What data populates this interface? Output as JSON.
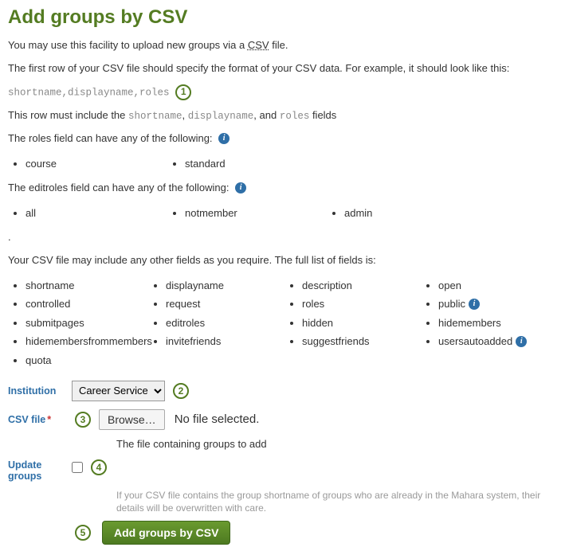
{
  "title": "Add groups by CSV",
  "intro_prefix": "You may use this facility to upload new groups via a ",
  "intro_csv_link": "CSV",
  "intro_suffix": " file.",
  "first_row": "The first row of your CSV file should specify the format of your CSV data. For example, it should look like this:",
  "example_row": "shortname,displayname,roles",
  "must_include_prefix": "This row must include the ",
  "must_include_s": "shortname",
  "must_include_sep1": ", ",
  "must_include_d": "displayname",
  "must_include_sep2": ", and ",
  "must_include_r": "roles",
  "must_include_suffix": " fields",
  "roles_intro": "The roles field can have any of the following:",
  "roles_values": [
    "course",
    "standard"
  ],
  "editroles_intro": "The editroles field can have any of the following:",
  "editroles_values": [
    "all",
    "notmember",
    "admin"
  ],
  "dot_line": ".",
  "full_intro": "Your CSV file may include any other fields as you require. The full list of fields is:",
  "full_col0": [
    "shortname",
    "controlled",
    "submitpages",
    "hidemembersfrommembers",
    "quota"
  ],
  "full_col1": [
    "displayname",
    "request",
    "editroles",
    "invitefriends"
  ],
  "full_col2": [
    "description",
    "roles",
    "hidden",
    "suggestfriends"
  ],
  "full_col3": [
    "open",
    "public",
    "hidemembers",
    "usersautoadded"
  ],
  "full_info_col3": {
    "1": true,
    "3": true
  },
  "form": {
    "institution_label": "Institution",
    "institution_option": "Career Service",
    "csv_label": "CSV file",
    "required_mark": "*",
    "browse_label": "Browse…",
    "no_file_text": "No file selected.",
    "csv_help": "The file containing groups to add",
    "update_label": "Update groups",
    "update_help": "If your CSV file contains the group shortname of groups who are already in the Mahara system, their details will be overwritten with care.",
    "submit_label": "Add groups by CSV"
  },
  "callouts": {
    "c1": "1",
    "c2": "2",
    "c3": "3",
    "c4": "4",
    "c5": "5"
  }
}
